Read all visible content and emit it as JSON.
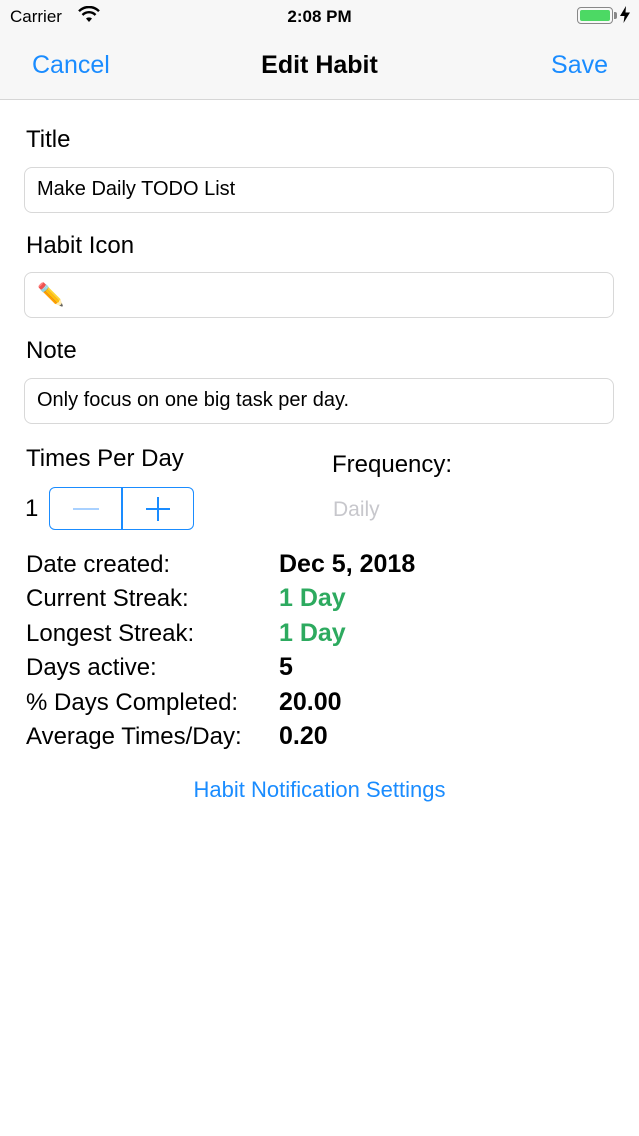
{
  "status_bar": {
    "carrier": "Carrier",
    "time": "2:08 PM",
    "battery_level": 1.0
  },
  "nav": {
    "cancel_label": "Cancel",
    "title": "Edit Habit",
    "save_label": "Save"
  },
  "form": {
    "title_label": "Title",
    "title_value": "Make Daily TODO List",
    "icon_label": "Habit Icon",
    "icon_value": "✏️",
    "note_label": "Note",
    "note_value": "Only focus on one big task per day.",
    "times_per_day_label": "Times Per Day",
    "times_per_day_value": "1",
    "frequency_label": "Frequency:",
    "frequency_value": "Daily"
  },
  "stats": [
    {
      "label": "Date created:",
      "value": "Dec 5, 2018",
      "highlight": false
    },
    {
      "label": "Current Streak:",
      "value": "1 Day",
      "highlight": true
    },
    {
      "label": "Longest Streak:",
      "value": "1 Day",
      "highlight": true
    },
    {
      "label": "Days active:",
      "value": "5",
      "highlight": false
    },
    {
      "label": "% Days Completed:",
      "value": "20.00",
      "highlight": false
    },
    {
      "label": "Average Times/Day:",
      "value": "0.20",
      "highlight": false
    }
  ],
  "notification_link": "Habit Notification Settings",
  "colors": {
    "accent": "#1a8cff",
    "streak_green": "#2daa5f",
    "disabled_gray": "#c7c7cc"
  }
}
